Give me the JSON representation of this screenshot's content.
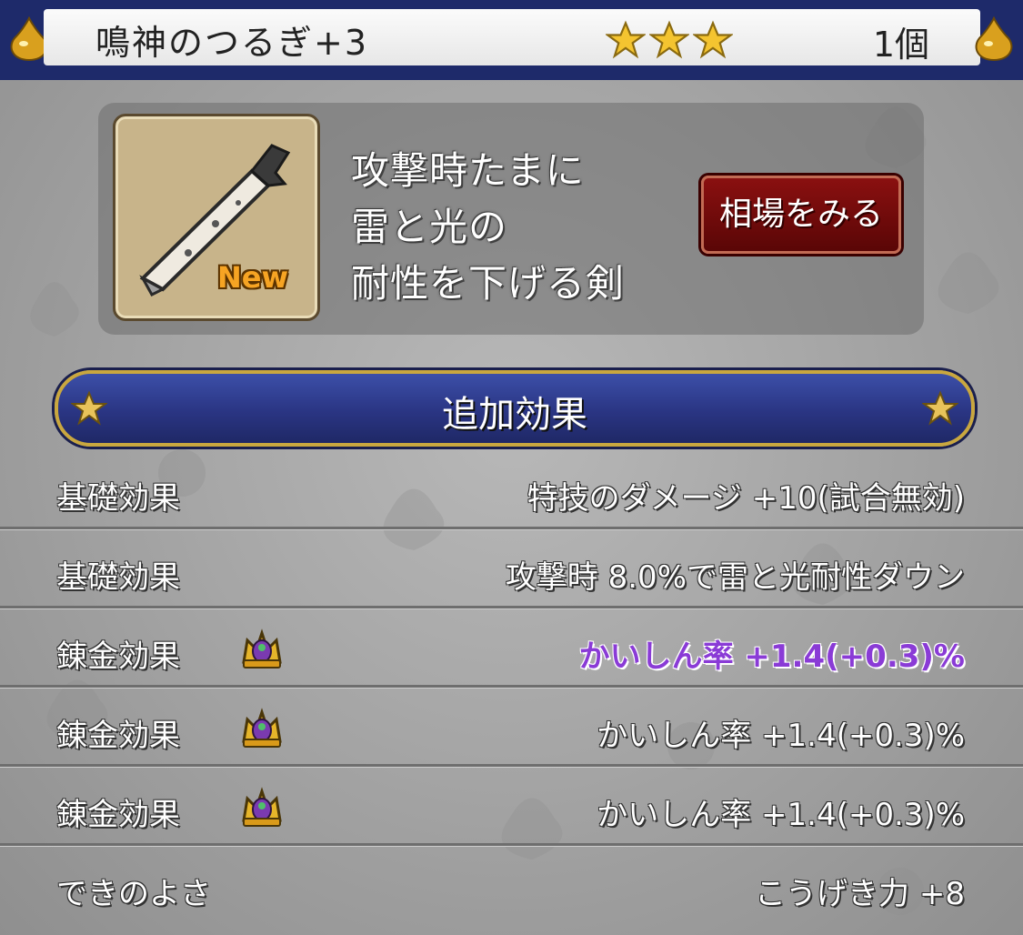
{
  "item": {
    "name": "鳴神のつるぎ+3",
    "star_count": 3,
    "quantity": "1個",
    "new_badge": "New",
    "description_lines": [
      "攻撃時たまに",
      "雷と光の",
      "耐性を下げる剣"
    ],
    "market_button": "相場をみる"
  },
  "section": {
    "title": "追加効果"
  },
  "effects": [
    {
      "label": "基礎効果",
      "value": "特技のダメージ +10(試合無効)",
      "crown": false,
      "highlight": false
    },
    {
      "label": "基礎効果",
      "value": "攻撃時 8.0%で雷と光耐性ダウン",
      "crown": false,
      "highlight": false
    },
    {
      "label": "錬金効果",
      "value": "かいしん率 +1.4(+0.3)%",
      "crown": true,
      "highlight": true
    },
    {
      "label": "錬金効果",
      "value": "かいしん率 +1.4(+0.3)%",
      "crown": true,
      "highlight": false
    },
    {
      "label": "錬金効果",
      "value": "かいしん率 +1.4(+0.3)%",
      "crown": true,
      "highlight": false
    },
    {
      "label": "できのよさ",
      "value": "こうげき力 +8",
      "crown": false,
      "highlight": false
    }
  ],
  "colors": {
    "title_bar": "#1e2a6a",
    "section_header": "#2a3583",
    "section_border": "#c9a73f",
    "highlight_text": "#8a3bd6",
    "market_button": "#7a0c0c",
    "star": "#f4c430"
  },
  "icons": {
    "title_left": "slime-drop-icon",
    "title_right": "slime-drop-icon",
    "rarity": "star-icon",
    "alchemy": "crown-icon",
    "item": "sword-icon"
  }
}
